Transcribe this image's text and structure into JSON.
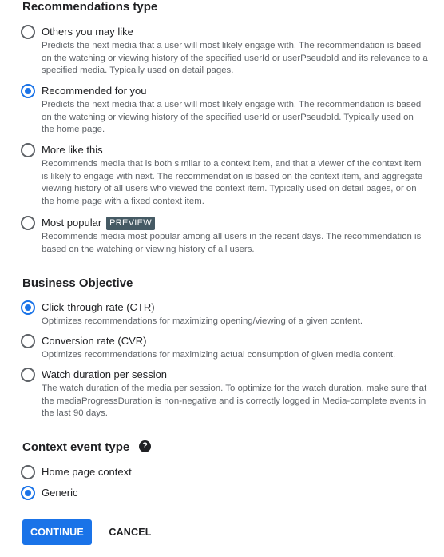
{
  "recommendations": {
    "title": "Recommendations type",
    "options": [
      {
        "label": "Others you may like",
        "description": "Predicts the next media that a user will most likely engage with. The recommendation is based on the watching or viewing history of the specified userId or userPseudoId and its relevance to a specified media. Typically used on detail pages.",
        "selected": false
      },
      {
        "label": "Recommended for you",
        "description": "Predicts the next media that a user will most likely engage with. The recommendation is based on the watching or viewing history of the specified userId or userPseudoId. Typically used on the home page.",
        "selected": true
      },
      {
        "label": "More like this",
        "description": "Recommends media that is both similar to a context item, and that a viewer of the context item is likely to engage with next. The recommendation is based on the context item, and aggregate viewing history of all users who viewed the context item. Typically used on detail pages, or on the home page with a fixed context item.",
        "selected": false
      },
      {
        "label": "Most popular",
        "badge": "PREVIEW",
        "description": "Recommends media most popular among all users in the recent days. The recommendation is based on the watching or viewing history of all users.",
        "selected": false
      }
    ]
  },
  "business_objective": {
    "title": "Business Objective",
    "options": [
      {
        "label": "Click-through rate (CTR)",
        "description": "Optimizes recommendations for maximizing opening/viewing of a given content.",
        "selected": true
      },
      {
        "label": "Conversion rate (CVR)",
        "description": "Optimizes recommendations for maximizing actual consumption of given media content.",
        "selected": false
      },
      {
        "label": "Watch duration per session",
        "description": "The watch duration of the media per session. To optimize for the watch duration, make sure that the mediaProgressDuration is non-negative and is correctly logged in Media-complete events in the last 90 days.",
        "selected": false
      }
    ]
  },
  "context_event": {
    "title": "Context event type",
    "help_icon": "help-circle-icon",
    "help_glyph": "?",
    "options": [
      {
        "label": "Home page context",
        "selected": false
      },
      {
        "label": "Generic",
        "selected": true
      }
    ]
  },
  "actions": {
    "continue_label": "CONTINUE",
    "cancel_label": "CANCEL"
  },
  "colors": {
    "accent": "#1a73e8",
    "badge_bg": "#455a64",
    "description_text": "#5f6368"
  }
}
